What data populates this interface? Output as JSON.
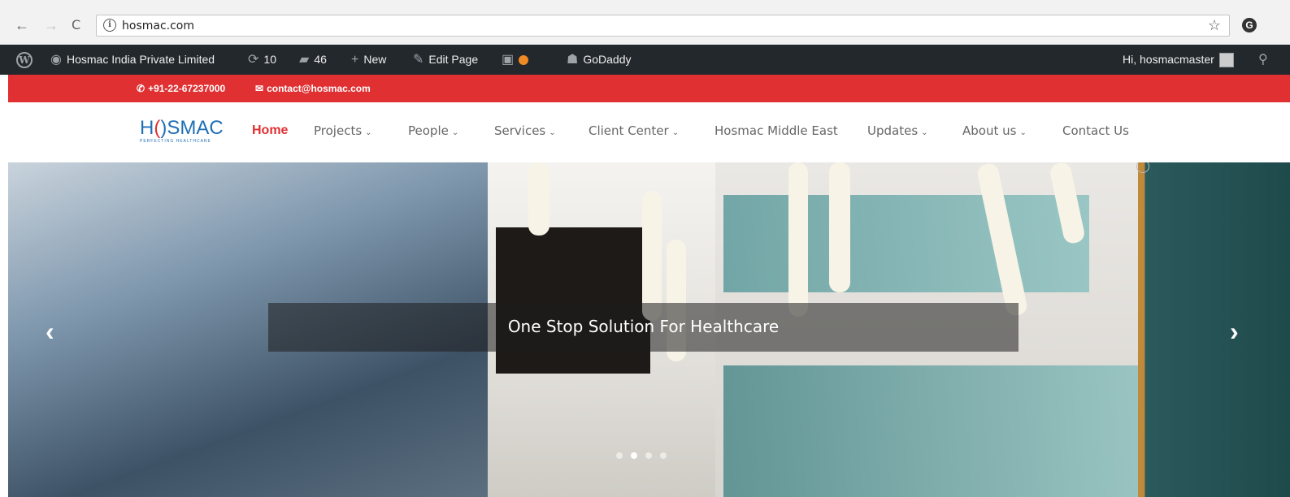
{
  "browser": {
    "back": "←",
    "forward": "→",
    "reload": "C",
    "url": "hosmac.com"
  },
  "adminbar": {
    "site_name": "Hosmac India Private Limited",
    "updates_count": "10",
    "comments_count": "46",
    "new_label": "New",
    "edit_label": "Edit Page",
    "godaddy_label": "GoDaddy",
    "greeting": "Hi, hosmacmaster"
  },
  "topbar": {
    "phone": "+91-22-67237000",
    "email": "contact@hosmac.com",
    "accent": "#e03032"
  },
  "logo": {
    "word_a": "H",
    "word_o": "(",
    "word_b": ")SMAC",
    "tagline": "PERFECTING HEALTHCARE"
  },
  "nav": {
    "items": [
      {
        "label": "Home",
        "caret": false
      },
      {
        "label": "Projects",
        "caret": true
      },
      {
        "label": "People",
        "caret": true
      },
      {
        "label": "Services",
        "caret": true
      },
      {
        "label": "Client Center",
        "caret": true
      },
      {
        "label": "Hosmac Middle East",
        "caret": false
      },
      {
        "label": "Updates",
        "caret": true
      },
      {
        "label": "About us",
        "caret": true
      },
      {
        "label": "Contact Us",
        "caret": false
      }
    ]
  },
  "hero": {
    "caption": "One Stop Solution For Healthcare",
    "prev": "‹",
    "next": "›",
    "slides_count": 4,
    "active_slide": 2
  }
}
